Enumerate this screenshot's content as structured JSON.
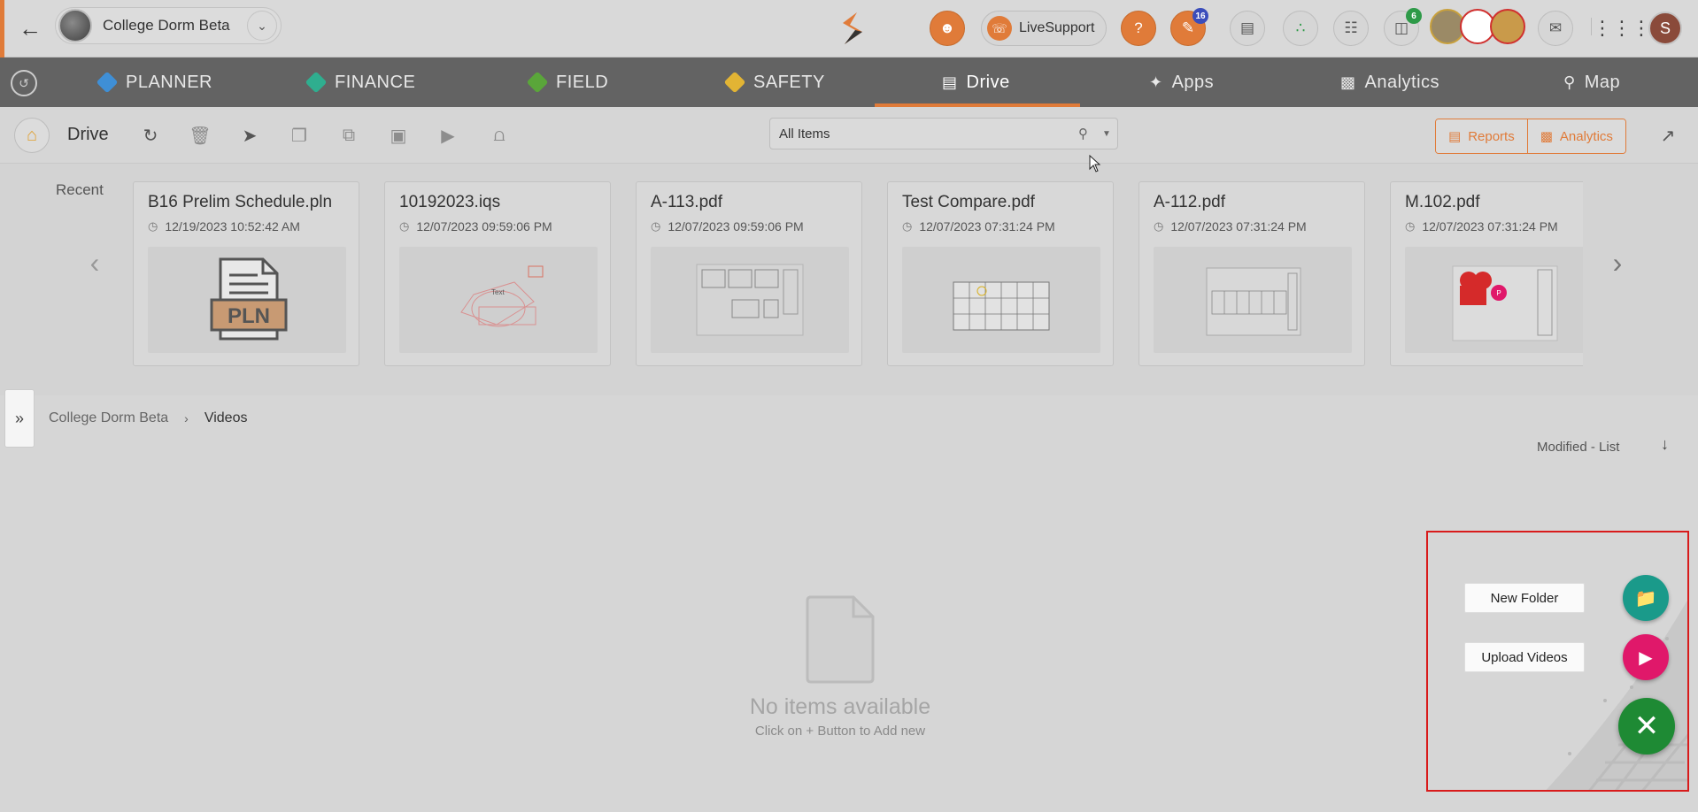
{
  "header": {
    "project_name": "College Dorm Beta",
    "live_support_label": "LiveSupport",
    "notifications_badge": "16",
    "cart_badge": "6",
    "user_initial": "S"
  },
  "modules": [
    {
      "label": "PLANNER",
      "icon": "planner-icon",
      "color": "#3f8fd6"
    },
    {
      "label": "FINANCE",
      "icon": "finance-icon",
      "color": "#2fae8f"
    },
    {
      "label": "FIELD",
      "icon": "field-icon",
      "color": "#5aa63a"
    },
    {
      "label": "SAFETY",
      "icon": "safety-icon",
      "color": "#e2b434"
    },
    {
      "label": "Drive",
      "icon": "drive-icon",
      "active": true
    },
    {
      "label": "Apps",
      "icon": "apps-icon"
    },
    {
      "label": "Analytics",
      "icon": "analytics-icon"
    },
    {
      "label": "Map",
      "icon": "map-icon"
    }
  ],
  "toolbar": {
    "title": "Drive",
    "filter_value": "All Items",
    "reports_label": "Reports",
    "analytics_label": "Analytics"
  },
  "recent": {
    "label": "Recent",
    "items": [
      {
        "name": "B16 Prelim Schedule.pln",
        "date": "12/19/2023 10:52:42 AM",
        "thumb": "pln"
      },
      {
        "name": "10192023.iqs",
        "date": "12/07/2023 09:59:06 PM",
        "thumb": "sketch"
      },
      {
        "name": "A-113.pdf",
        "date": "12/07/2023 09:59:06 PM",
        "thumb": "drawing"
      },
      {
        "name": "Test Compare.pdf",
        "date": "12/07/2023 07:31:24 PM",
        "thumb": "plan"
      },
      {
        "name": "A-112.pdf",
        "date": "12/07/2023 07:31:24 PM",
        "thumb": "plan2"
      },
      {
        "name": "M.102.pdf",
        "date": "12/07/2023 07:31:24 PM",
        "thumb": "markup"
      }
    ]
  },
  "breadcrumb": {
    "root": "College Dorm Beta",
    "current": "Videos"
  },
  "sort_label": "Modified - List",
  "empty": {
    "title": "No items available",
    "subtitle": "Click on + Button to Add new"
  },
  "fab": {
    "new_folder_label": "New Folder",
    "upload_videos_label": "Upload Videos"
  },
  "colors": {
    "accent": "#e07b39",
    "fab_teal": "#1a9a8a",
    "fab_pink": "#e0186a",
    "fab_green": "#1e8a34",
    "highlight_border": "#d81b1b"
  }
}
